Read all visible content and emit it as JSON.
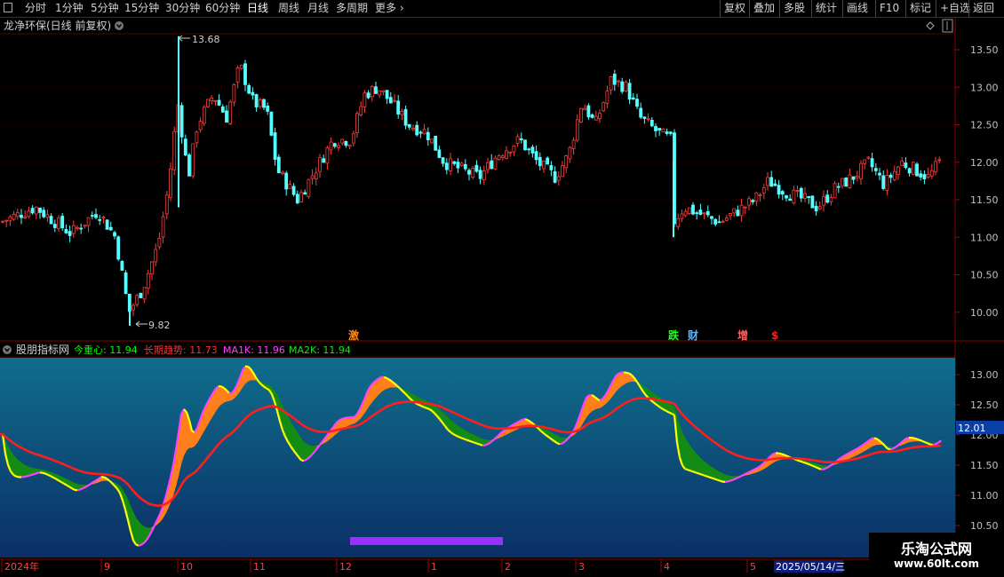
{
  "toolbar": {
    "periods": [
      "分时",
      "1分钟",
      "5分钟",
      "15分钟",
      "30分钟",
      "60分钟",
      "日线",
      "周线",
      "月线",
      "多周期",
      "更多"
    ],
    "active_period": "日线",
    "actions": [
      "复权",
      "叠加",
      "多股",
      "统计",
      "画线",
      "F10",
      "标记",
      "+自选",
      "返回"
    ]
  },
  "price_panel": {
    "title": "龙净环保(日线 前复权)",
    "high_label": "13.68",
    "low_label": "9.82",
    "y_ticks": [
      "13.50",
      "13.00",
      "12.50",
      "12.00",
      "11.50",
      "11.00",
      "10.50",
      "10.00"
    ],
    "event_markers": [
      "激",
      "跌",
      "财",
      "增",
      "$"
    ]
  },
  "indicator_panel": {
    "name": "股朋指标网",
    "legend": [
      {
        "label": "今重心:",
        "value": "11.94",
        "color": "#00ff00"
      },
      {
        "label": "长期趋势:",
        "value": "11.73",
        "color": "#ff3030"
      },
      {
        "label": "MA1K:",
        "value": "11.96",
        "color": "#ff40ff"
      },
      {
        "label": "MA2K:",
        "value": "11.94",
        "color": "#20e020"
      }
    ],
    "y_ticks": [
      "13.00",
      "12.50",
      "12.00",
      "11.50",
      "11.00",
      "10.50"
    ],
    "current_value": "12.01"
  },
  "x_axis": {
    "labels": [
      "2024年",
      "9",
      "10",
      "11",
      "12",
      "1",
      "2",
      "3",
      "4",
      "5"
    ],
    "cursor_date": "2025/05/14/三"
  },
  "logo": {
    "title": "乐淘公式网",
    "url": "www.60lt.com"
  },
  "colors": {
    "up": "#ff3c3c",
    "down": "#54ffff",
    "indicator_bg_top": "#0f6e8c",
    "indicator_bg_bottom": "#0b2f66",
    "long_trend": "#ff1e1e",
    "ma1k": "#ff40ff",
    "ma_yellow": "#ffff00",
    "band_orange": "#ff7f1a",
    "band_green": "#148c14"
  },
  "chart_data": {
    "type": "candlestick",
    "ylim_price": [
      9.6,
      13.8
    ],
    "ylim_indicator": [
      10.4,
      13.2
    ],
    "anchors": [
      {
        "x": 0,
        "c": 11.2
      },
      {
        "x": 40,
        "c": 11.4
      },
      {
        "x": 80,
        "c": 11.05
      },
      {
        "x": 110,
        "c": 11.35
      },
      {
        "x": 130,
        "c": 11.0
      },
      {
        "x": 145,
        "c": 10.0
      },
      {
        "x": 160,
        "c": 10.3
      },
      {
        "x": 178,
        "c": 10.9
      },
      {
        "x": 190,
        "c": 11.7
      },
      {
        "x": 200,
        "c": 12.8
      },
      {
        "x": 212,
        "c": 11.8
      },
      {
        "x": 222,
        "c": 12.5
      },
      {
        "x": 240,
        "c": 12.9
      },
      {
        "x": 255,
        "c": 12.6
      },
      {
        "x": 270,
        "c": 13.3
      },
      {
        "x": 285,
        "c": 12.8
      },
      {
        "x": 300,
        "c": 12.7
      },
      {
        "x": 312,
        "c": 11.9
      },
      {
        "x": 335,
        "c": 11.5
      },
      {
        "x": 355,
        "c": 11.9
      },
      {
        "x": 375,
        "c": 12.3
      },
      {
        "x": 395,
        "c": 12.3
      },
      {
        "x": 410,
        "c": 12.9
      },
      {
        "x": 425,
        "c": 13.0
      },
      {
        "x": 440,
        "c": 12.8
      },
      {
        "x": 460,
        "c": 12.5
      },
      {
        "x": 480,
        "c": 12.4
      },
      {
        "x": 500,
        "c": 12.0
      },
      {
        "x": 520,
        "c": 11.9
      },
      {
        "x": 540,
        "c": 11.8
      },
      {
        "x": 560,
        "c": 12.1
      },
      {
        "x": 585,
        "c": 12.3
      },
      {
        "x": 605,
        "c": 12.0
      },
      {
        "x": 625,
        "c": 11.8
      },
      {
        "x": 640,
        "c": 12.1
      },
      {
        "x": 655,
        "c": 12.8
      },
      {
        "x": 670,
        "c": 12.5
      },
      {
        "x": 688,
        "c": 13.1
      },
      {
        "x": 705,
        "c": 13.0
      },
      {
        "x": 720,
        "c": 12.6
      },
      {
        "x": 740,
        "c": 12.4
      },
      {
        "x": 755,
        "c": 12.3
      },
      {
        "x": 758,
        "c": 11.2
      },
      {
        "x": 770,
        "c": 11.4
      },
      {
        "x": 790,
        "c": 11.3
      },
      {
        "x": 810,
        "c": 11.2
      },
      {
        "x": 830,
        "c": 11.35
      },
      {
        "x": 850,
        "c": 11.5
      },
      {
        "x": 865,
        "c": 11.75
      },
      {
        "x": 885,
        "c": 11.6
      },
      {
        "x": 905,
        "c": 11.5
      },
      {
        "x": 920,
        "c": 11.4
      },
      {
        "x": 940,
        "c": 11.65
      },
      {
        "x": 960,
        "c": 11.8
      },
      {
        "x": 978,
        "c": 12.0
      },
      {
        "x": 995,
        "c": 11.7
      },
      {
        "x": 1015,
        "c": 12.0
      },
      {
        "x": 1030,
        "c": 11.9
      },
      {
        "x": 1045,
        "c": 11.8
      },
      {
        "x": 1058,
        "c": 12.01
      }
    ]
  }
}
